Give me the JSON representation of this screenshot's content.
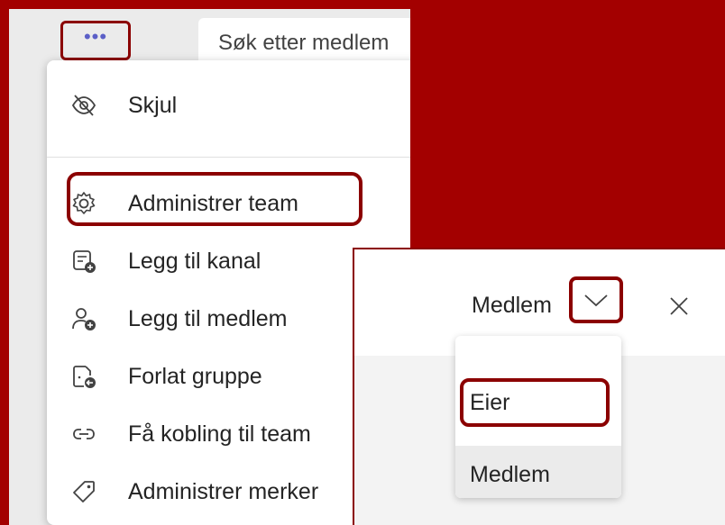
{
  "toolbar": {
    "more_label": "•••"
  },
  "search": {
    "text": "Søk etter medlem"
  },
  "menu": {
    "items": [
      {
        "label": "Skjul",
        "icon": "eye-off-icon"
      },
      {
        "label": "Administrer team",
        "icon": "gear-icon"
      },
      {
        "label": "Legg til kanal",
        "icon": "add-channel-icon"
      },
      {
        "label": "Legg til medlem",
        "icon": "add-person-icon"
      },
      {
        "label": "Forlat gruppe",
        "icon": "leave-icon"
      },
      {
        "label": "Få kobling til team",
        "icon": "link-icon"
      },
      {
        "label": "Administrer merker",
        "icon": "tag-icon"
      }
    ]
  },
  "role_panel": {
    "current_role": "Medlem",
    "options": [
      {
        "label": "Eier",
        "selected": false
      },
      {
        "label": "Medlem",
        "selected": true
      }
    ]
  },
  "colors": {
    "backdrop": "#a30000",
    "highlight": "#8b0000",
    "accent": "#5b5fc7"
  }
}
